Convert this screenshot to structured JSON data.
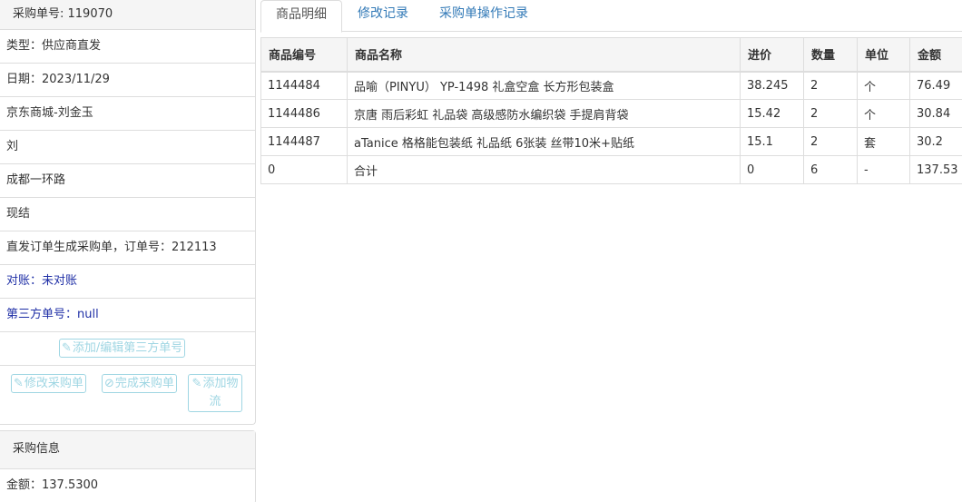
{
  "order_panel": {
    "heading": "采购单号: 119070",
    "rows": [
      {
        "text": "类型：供应商直发"
      },
      {
        "text": "日期：2023/11/29"
      },
      {
        "text": "京东商城-刘金玉"
      },
      {
        "text": "刘"
      },
      {
        "text": "成都一环路"
      },
      {
        "text": "现结"
      },
      {
        "text": "直发订单生成采购单，订单号：212113"
      }
    ],
    "reconcile": {
      "label": "对账：",
      "value": "未对账"
    },
    "third_party": {
      "label": "第三方单号：",
      "value": "null"
    },
    "buttons": {
      "add_third_party": "添加/编辑第三方单号",
      "modify_order": "修改采购单",
      "complete_order": "完成采购单",
      "add_logistics": "添加物流"
    }
  },
  "info_panel": {
    "heading": "采购信息",
    "amount": "金额：137.5300"
  },
  "tabs": [
    {
      "label": "商品明细",
      "active": true
    },
    {
      "label": "修改记录",
      "active": false
    },
    {
      "label": "采购单操作记录",
      "active": false
    }
  ],
  "table": {
    "headers": [
      "商品编号",
      "商品名称",
      "进价",
      "数量",
      "单位",
      "金额"
    ],
    "rows": [
      [
        "1144484",
        "品喻（PINYU） YP-1498 礼盒空盒 长方形包装盒",
        "38.245",
        "2",
        "个",
        "76.49"
      ],
      [
        "1144486",
        "京唐 雨后彩虹 礼品袋 高级感防水编织袋 手提肩背袋",
        "15.42",
        "2",
        "个",
        "30.84"
      ],
      [
        "1144487",
        "aTanice 格格能包装纸 礼品纸 6张装 丝带10米+贴纸",
        "15.1",
        "2",
        "套",
        "30.2"
      ],
      [
        "0",
        "合计",
        "0",
        "6",
        "-",
        "137.53"
      ]
    ]
  },
  "colors": {
    "link": "#337ab7",
    "dark_blue": "#1f2fa6",
    "disabled_button": "#9fd6e3"
  },
  "icons": {
    "edit": "edit-icon",
    "check": "check-circle-icon"
  }
}
